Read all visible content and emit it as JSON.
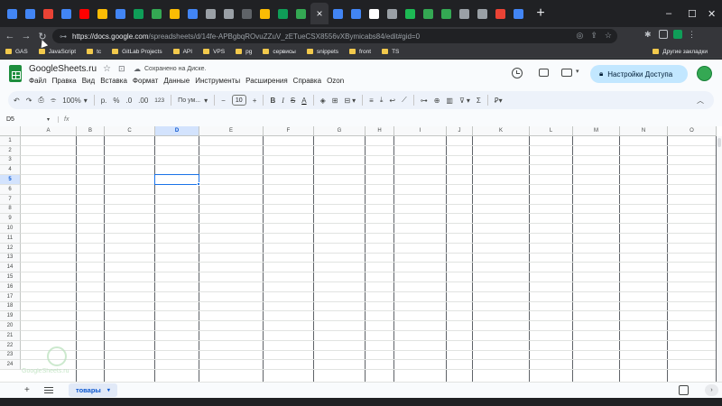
{
  "browser": {
    "tabs": [
      {
        "icon": "docs-icon",
        "color": "#4285f4"
      },
      {
        "icon": "docs-icon",
        "color": "#4285f4"
      },
      {
        "icon": "chrome-icon",
        "color": "#ea4335"
      },
      {
        "icon": "docs-icon",
        "color": "#4285f4"
      },
      {
        "icon": "youtube-icon",
        "color": "#ff0000"
      },
      {
        "icon": "photos-icon",
        "color": "#fbbc04"
      },
      {
        "icon": "docs-icon",
        "color": "#4285f4"
      },
      {
        "icon": "sheets-icon",
        "color": "#0f9d58"
      },
      {
        "icon": "apps-script-icon",
        "color": "#34a853"
      },
      {
        "icon": "drive-icon",
        "color": "#fbbc04"
      },
      {
        "icon": "docs-icon",
        "color": "#4285f4"
      },
      {
        "icon": "circle-icon",
        "color": "#9aa0a6"
      },
      {
        "icon": "chrome-icon",
        "color": "#9aa0a6"
      },
      {
        "icon": "blank-icon",
        "color": "#5f6368"
      },
      {
        "icon": "drive-icon",
        "color": "#fbbc04"
      },
      {
        "icon": "sheets-icon",
        "color": "#0f9d58"
      },
      {
        "icon": "apps-script-icon",
        "color": "#34a853"
      },
      {
        "icon": "sheets-icon",
        "color": "#0f9d58",
        "active": true
      },
      {
        "icon": "docs-icon",
        "color": "#4285f4"
      },
      {
        "icon": "docs-icon",
        "color": "#4285f4"
      },
      {
        "icon": "github-icon",
        "color": "#ffffff"
      },
      {
        "icon": "chrome-icon",
        "color": "#9aa0a6"
      },
      {
        "icon": "spotify-icon",
        "color": "#1db954"
      },
      {
        "icon": "apps-script-icon",
        "color": "#34a853"
      },
      {
        "icon": "apps-script-icon",
        "color": "#34a853"
      },
      {
        "icon": "settings-icon",
        "color": "#9aa0a6"
      },
      {
        "icon": "chrome-icon",
        "color": "#9aa0a6"
      },
      {
        "icon": "gmail-icon",
        "color": "#ea4335"
      },
      {
        "icon": "p-icon",
        "color": "#4285f4"
      }
    ],
    "new_tab_label": "+",
    "url_host": "https://docs.google.com",
    "url_path": "/spreadsheets/d/14fe-APBgbqROvuZZuV_zETueCSX8556vXBymicabs84/edit#gid=0",
    "bookmarks": [
      "GAS",
      "JavaScript",
      "tc",
      "GitLab Projects",
      "API",
      "VPS",
      "pg",
      "сервисы",
      "snippets",
      "front",
      "TS"
    ],
    "other_bookmarks": "Другие закладки"
  },
  "sheets": {
    "title": "GoogleSheets.ru",
    "saved_status": "Сохранено на Диске.",
    "menu": [
      "Файл",
      "Правка",
      "Вид",
      "Вставка",
      "Формат",
      "Данные",
      "Инструменты",
      "Расширения",
      "Справка",
      "Ozon"
    ],
    "share_label": "Настройки Доступа",
    "toolbar": {
      "zoom": "100%",
      "currency": "р.",
      "percent": "%",
      "dec_decrease": ".0",
      "dec_increase": ".00",
      "number_format": "123",
      "font": "По ум...",
      "font_size": "10",
      "minus": "−",
      "plus": "+",
      "bold": "B",
      "italic": "I",
      "strike": "S",
      "text_color": "A",
      "sigma": "Σ"
    },
    "name_box": "D5",
    "fx": "fx",
    "columns": [
      "A",
      "B",
      "C",
      "D",
      "E",
      "F",
      "G",
      "H",
      "I",
      "J",
      "K",
      "L",
      "M",
      "N",
      "O"
    ],
    "selected_column": "D",
    "rows": [
      "1",
      "2",
      "3",
      "4",
      "5",
      "6",
      "7",
      "8",
      "9",
      "10",
      "11",
      "12",
      "13",
      "14",
      "15",
      "16",
      "17",
      "18",
      "19",
      "20",
      "21",
      "22",
      "23",
      "24"
    ],
    "selected_row": "5",
    "sheet_tab": "товары",
    "add_sheet": "+"
  }
}
